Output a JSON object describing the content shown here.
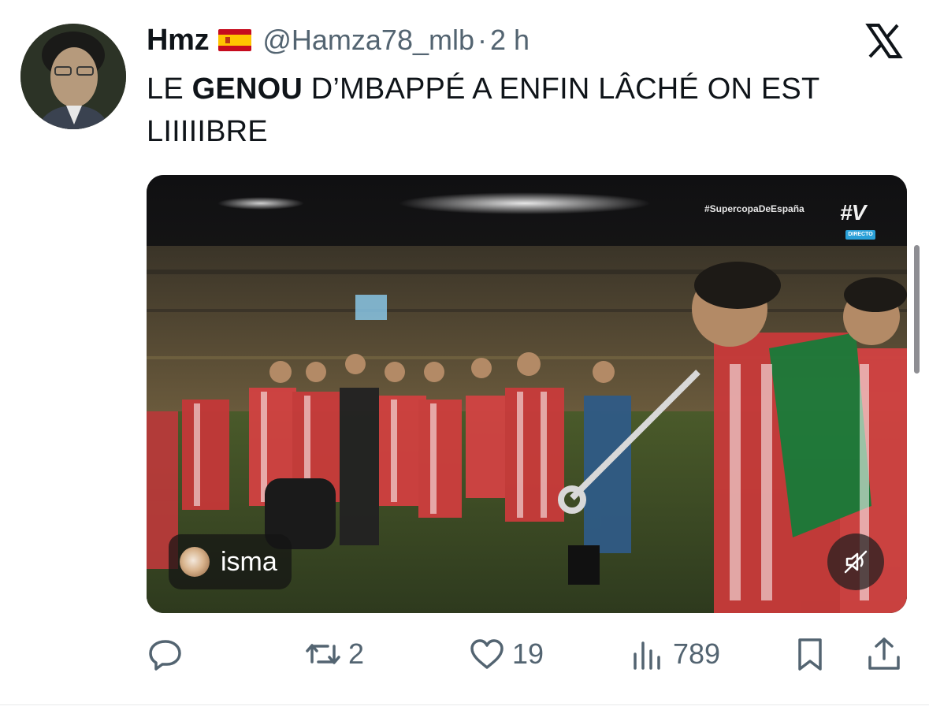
{
  "tweet": {
    "display_name": "Hmz",
    "flag_icon": "spain-flag-icon",
    "handle": "@Hamza78_mlb",
    "separator": "·",
    "time": "2 h",
    "text_before": "LE ",
    "text_bold": "GENOU",
    "text_after": " D’MBAPPÉ A ENFIN LÂCHÉ ON EST LIIIIIBRE"
  },
  "media": {
    "hashtag": "#SupercopaDeEspaña",
    "channel_logo": "#V",
    "live_badge": "DIRECTO",
    "user_chip_name": "isma",
    "mute_icon": "speaker-muted-icon"
  },
  "actions": {
    "reply": {
      "icon": "reply-icon"
    },
    "retweet": {
      "icon": "retweet-icon",
      "count": "2"
    },
    "like": {
      "icon": "heart-icon",
      "count": "19"
    },
    "views": {
      "icon": "views-icon",
      "count": "789"
    },
    "bookmark": {
      "icon": "bookmark-icon"
    },
    "share": {
      "icon": "share-icon"
    }
  },
  "colors": {
    "text_primary": "#0f1419",
    "text_secondary": "#536471",
    "divider": "#e7e9ea"
  }
}
